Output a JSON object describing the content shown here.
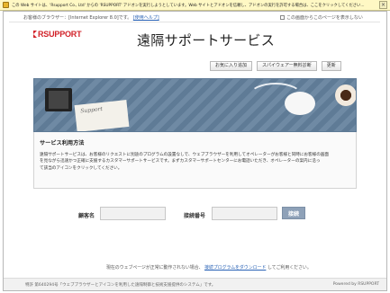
{
  "infobar": {
    "message": "この Web サイトは、'Rsupport Co., Ltd' からの 'RSUPPORT' アドオンを実行しようとしています。Web サイトとアドオンを信頼し、アドオンの実行を許可する場合は、ここをクリックしてください...",
    "close": "×"
  },
  "browser_note": {
    "text": "お客様のブラウザー：[Internet Explorer 8.0]です。",
    "link": "[使用ヘルプ]"
  },
  "hide_check": {
    "label": "この画面からこのページを表示しない"
  },
  "logo": {
    "text": "RSUPPORT"
  },
  "title": "遠隔サポートサービス",
  "buttons": {
    "favorite": "お気に入り追加",
    "spyware": "スパイウェアー無料診断",
    "refresh": "更新"
  },
  "banner": {
    "paper_text": "Support"
  },
  "usage": {
    "heading": "サービス利用方法",
    "lines": [
      "遠隔サポートサービスは、お客様のリクエストに別途のプログラムの設置なしで、ウェブブラウザーを利用してオペレーターがお客様と同時にお客様の画面",
      "を見ながら迅速かつ正確に支援するカスタマーサポートサービスです。まずカスタマーサポートセンターにお電話いただき、オペレーターの案内に沿っ",
      "て該当のアイコンをクリックしてください。"
    ]
  },
  "form": {
    "customer_label": "顧客名",
    "customer_value": "",
    "code_label": "接続番号",
    "code_value": "",
    "connect": "接続"
  },
  "hint": {
    "before": "現在のウェブページが正常に動作されない場合、",
    "link": "接続プログラムをダウンロード",
    "after": "してご利用ください。"
  },
  "footer": {
    "left": "特許 第640294号「ウェブブラウザーとアイコンを利用した遠隔制御と技術支援提供のシステム」です。",
    "right": "Powered by RSUPPORT"
  }
}
